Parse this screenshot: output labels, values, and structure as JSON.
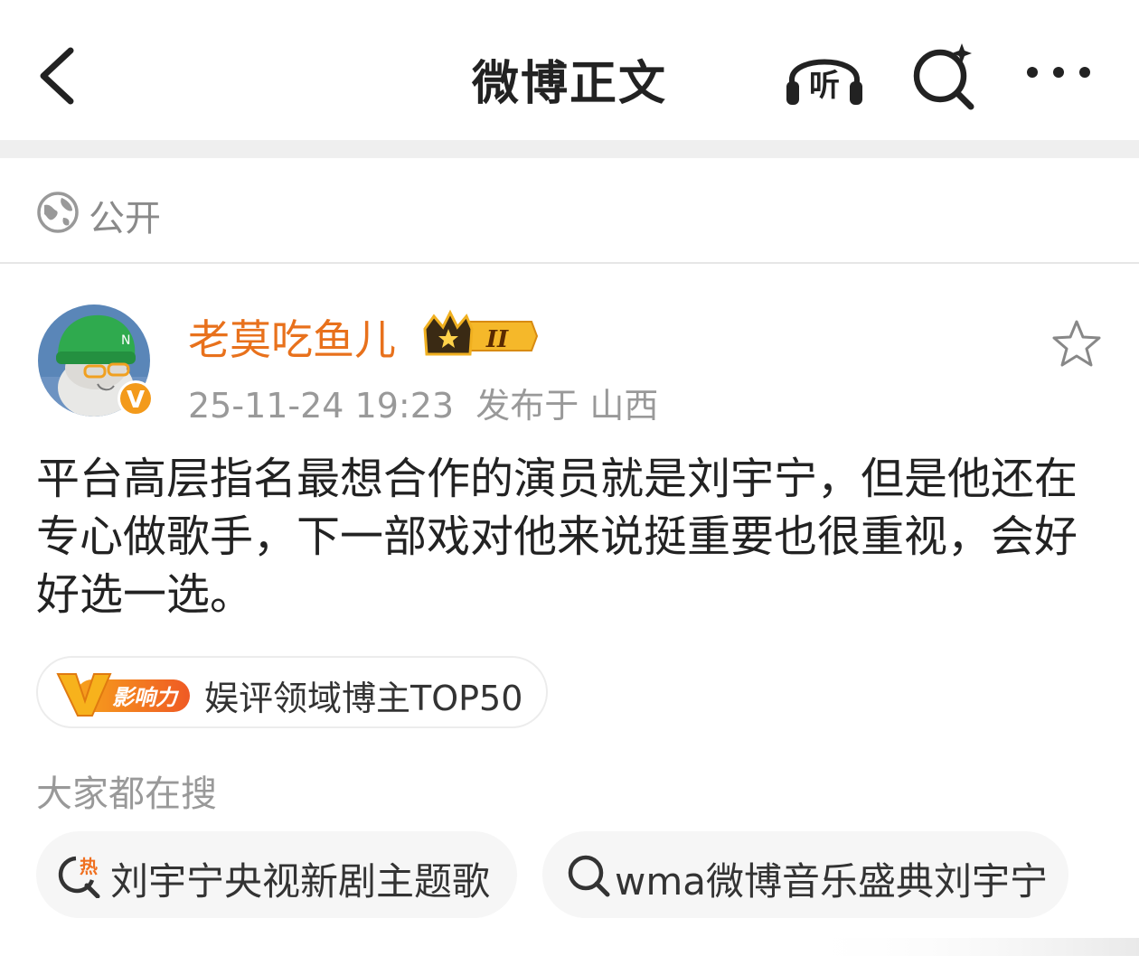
{
  "header": {
    "title": "微博正文",
    "listen_label": "听"
  },
  "visibility": {
    "label": "公开"
  },
  "author": {
    "name": "老莫吃鱼儿",
    "level_badge": "II",
    "date": "25-11-24 19:23",
    "location": "发布于 山西"
  },
  "post": {
    "text": "平台高层指名最想合作的演员就是刘宇宁，但是他还在专心做歌手，下一部戏对他来说挺重要也很重视，会好好选一选。"
  },
  "influence_badge": {
    "logo_text": "影响力",
    "text": "娱评领域博主TOP50"
  },
  "hot_search": {
    "label": "大家都在搜",
    "items": [
      {
        "text": "刘宇宁央视新剧主题歌",
        "icon": "hot-search-icon",
        "icon_text": "热"
      },
      {
        "text": "wma微博音乐盛典刘宇宁",
        "icon": "search-icon"
      }
    ]
  },
  "colors": {
    "username": "#e8711c",
    "accent_orange": "#f08a24",
    "text_gray": "#999999"
  }
}
